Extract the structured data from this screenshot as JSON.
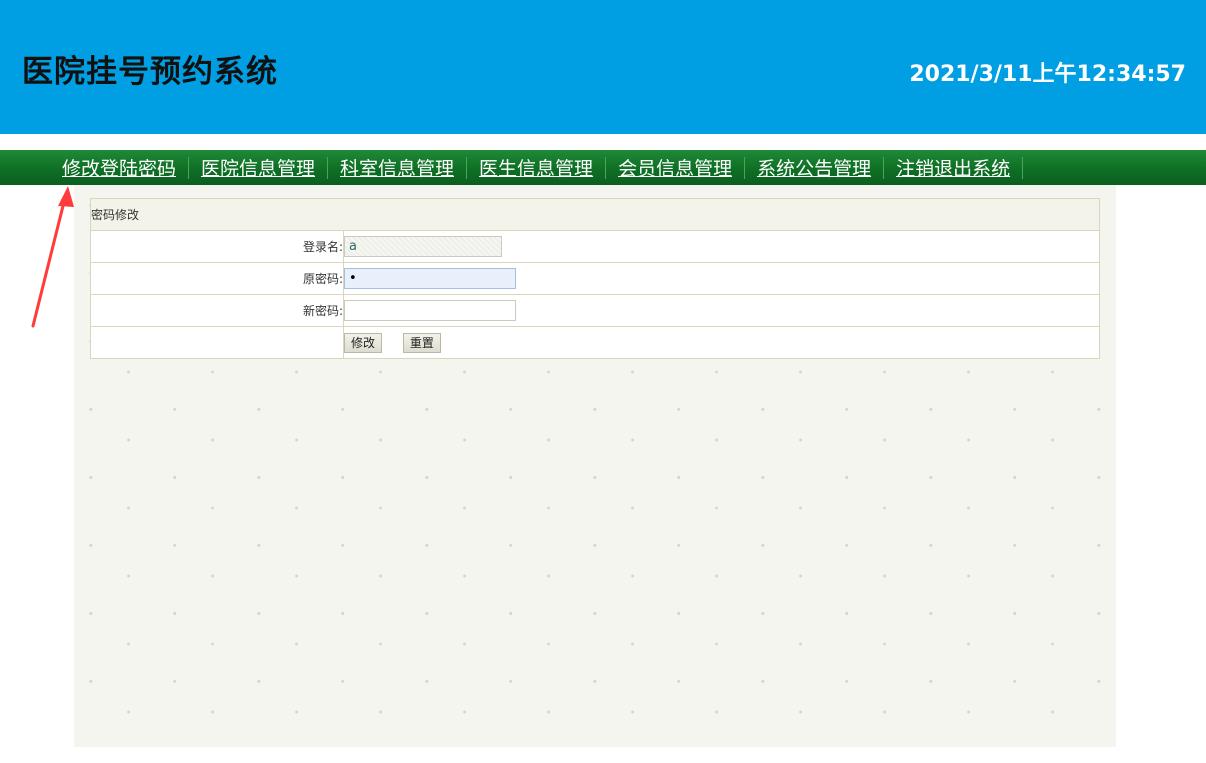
{
  "header": {
    "title": "医院挂号预约系统",
    "datetime": "2021/3/11上午12:34:57",
    "bg_color": "#009fe3"
  },
  "nav": {
    "items": [
      {
        "label": "修改登陆密码"
      },
      {
        "label": "医院信息管理"
      },
      {
        "label": "科室信息管理"
      },
      {
        "label": "医生信息管理"
      },
      {
        "label": "会员信息管理"
      },
      {
        "label": "系统公告管理"
      },
      {
        "label": "注销退出系统"
      }
    ],
    "bg_color": "#0e6f25"
  },
  "form": {
    "caption": "密码修改",
    "login_name_label": "登录名:",
    "login_name_value": "a",
    "old_password_label": "原密码:",
    "old_password_value": "•",
    "new_password_label": "新密码:",
    "new_password_value": "",
    "submit_label": "修改",
    "reset_label": "重置"
  },
  "annotation": {
    "icon": "arrow-icon",
    "color": "#ff3b3b"
  }
}
